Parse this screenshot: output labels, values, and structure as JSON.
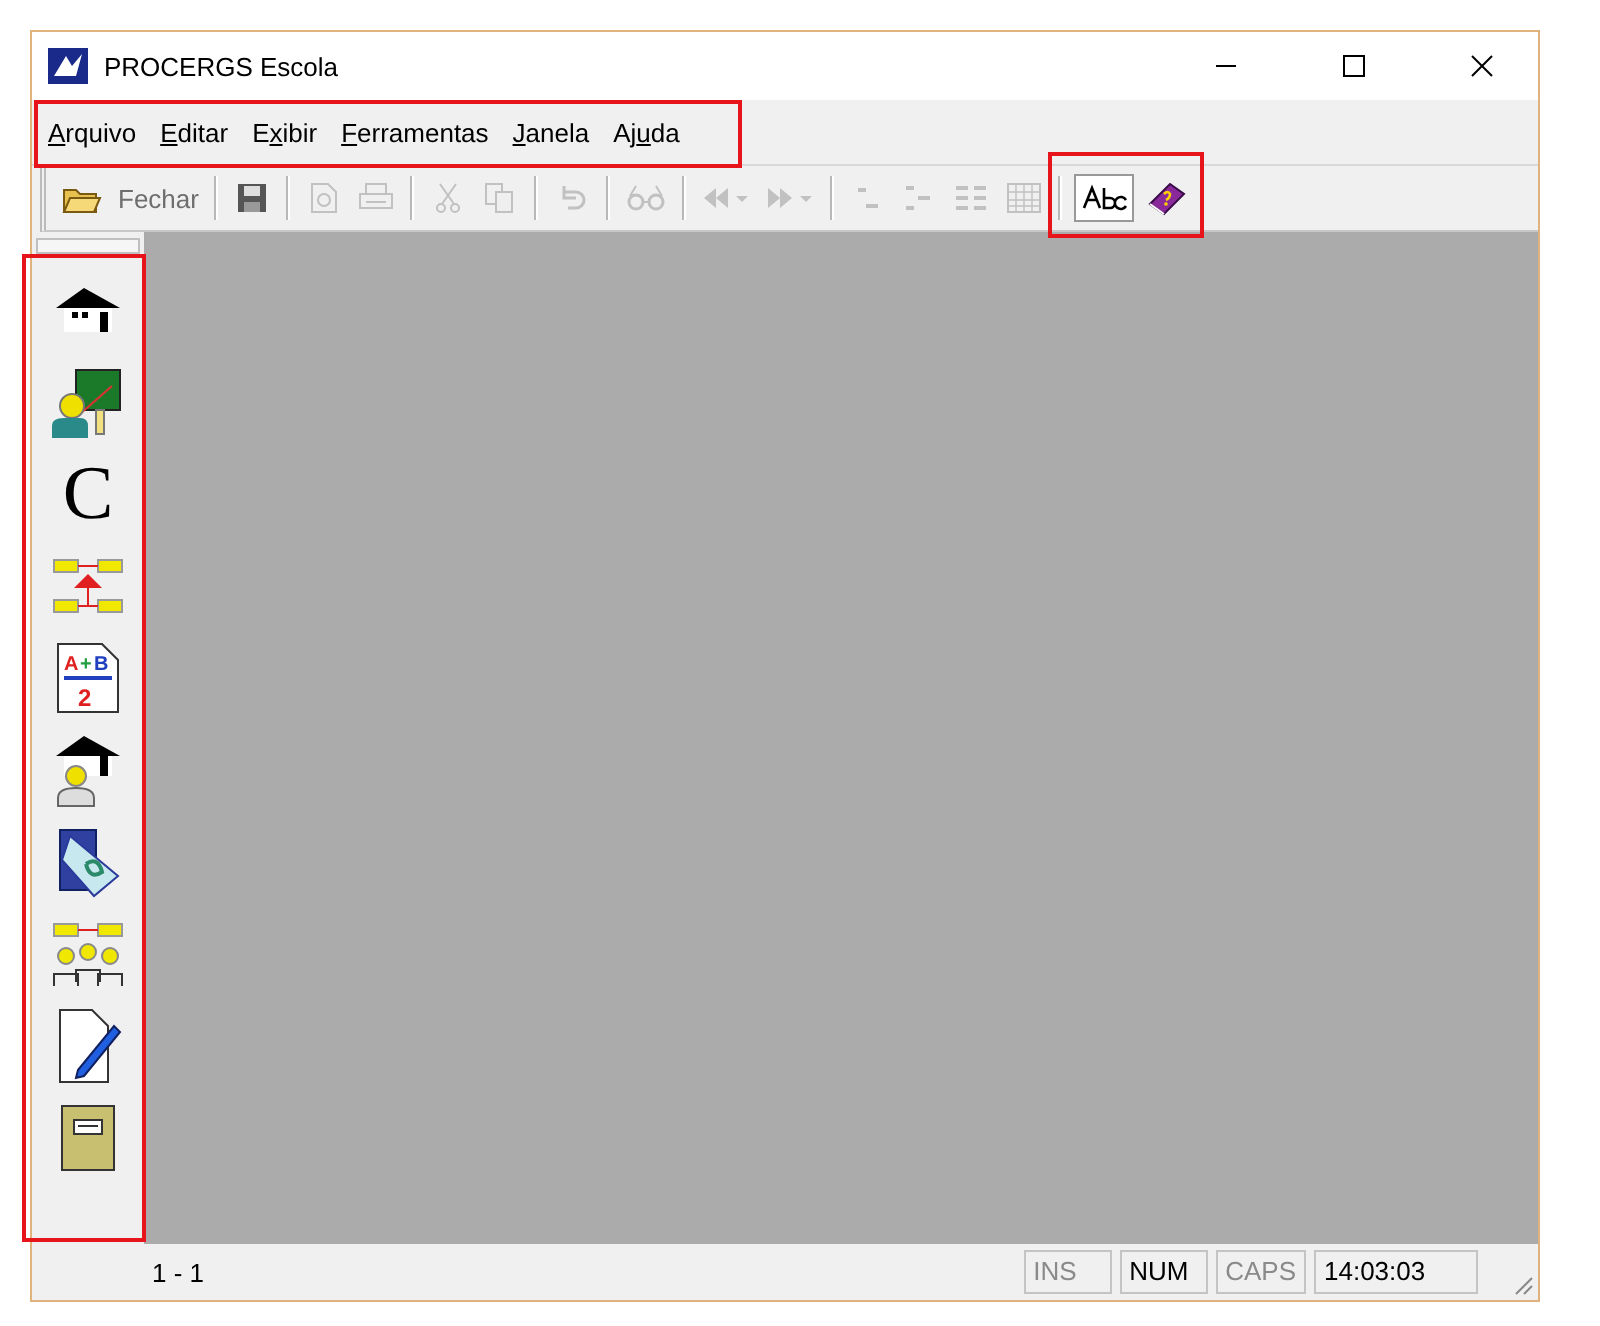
{
  "window": {
    "title": "PROCERGS Escola"
  },
  "menu": [
    {
      "key": "A",
      "after": "rquivo"
    },
    {
      "key": "E",
      "after": "ditar"
    },
    {
      "before": "E",
      "key": "x",
      "after": "ibir"
    },
    {
      "key": "F",
      "after": "erramentas"
    },
    {
      "key": "J",
      "after": "anela"
    },
    {
      "before": "Aj",
      "key": "u",
      "after": "da"
    }
  ],
  "toolbar": [
    {
      "kind": "open",
      "disabled": false
    },
    {
      "kind": "label",
      "label": "Fechar",
      "disabled": true
    },
    {
      "kind": "separator"
    },
    {
      "kind": "save",
      "disabled": false
    },
    {
      "kind": "separator"
    },
    {
      "kind": "preview",
      "disabled": true
    },
    {
      "kind": "print",
      "disabled": true
    },
    {
      "kind": "separator"
    },
    {
      "kind": "cut",
      "disabled": true
    },
    {
      "kind": "copy",
      "disabled": true
    },
    {
      "kind": "separator"
    },
    {
      "kind": "undo",
      "disabled": true
    },
    {
      "kind": "separator"
    },
    {
      "kind": "glasses",
      "disabled": true
    },
    {
      "kind": "separator"
    },
    {
      "kind": "back",
      "disabled": true
    },
    {
      "kind": "forward",
      "disabled": true
    },
    {
      "kind": "separator"
    },
    {
      "kind": "rows",
      "disabled": true
    },
    {
      "kind": "tree",
      "disabled": true
    },
    {
      "kind": "list",
      "disabled": true
    },
    {
      "kind": "grid",
      "disabled": true
    },
    {
      "kind": "separator"
    },
    {
      "kind": "spell",
      "disabled": false
    },
    {
      "kind": "help",
      "disabled": false
    }
  ],
  "sidebar": {
    "items": [
      {
        "kind": "school"
      },
      {
        "kind": "teacher"
      },
      {
        "kind": "letter",
        "label": "C"
      },
      {
        "kind": "transfer"
      },
      {
        "kind": "grades",
        "marks": [
          "A",
          "+",
          "B",
          "2"
        ]
      },
      {
        "kind": "student"
      },
      {
        "kind": "calendar"
      },
      {
        "kind": "groups"
      },
      {
        "kind": "edit"
      },
      {
        "kind": "book"
      }
    ]
  },
  "status_bar": {
    "position": "1 - 1",
    "indicators": [
      {
        "label": "INS",
        "on": false
      },
      {
        "label": "NUM",
        "on": true
      },
      {
        "label": "CAPS",
        "on": false
      }
    ],
    "time": "14:03:03"
  }
}
